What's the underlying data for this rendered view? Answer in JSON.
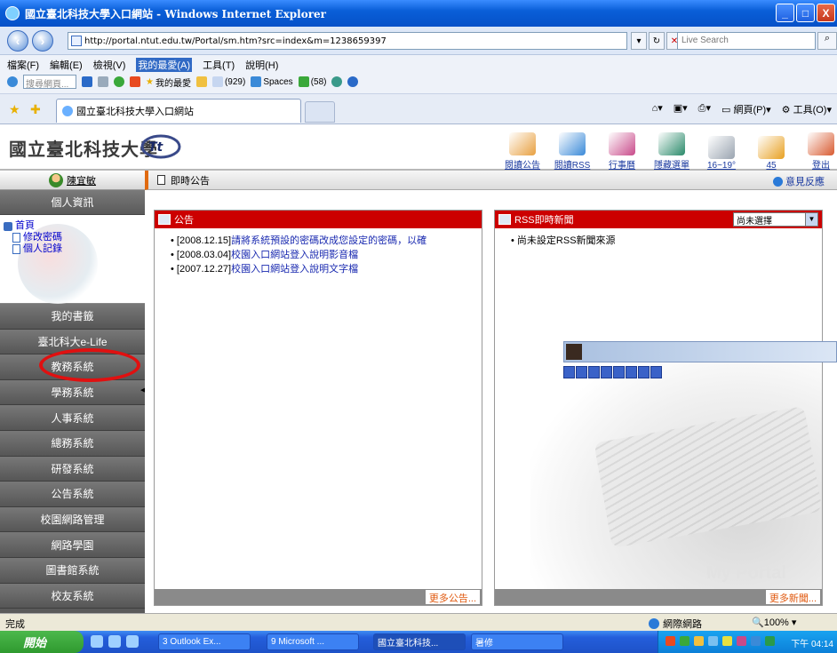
{
  "window": {
    "title": "國立臺北科技大學入口網站 - Windows Internet Explorer",
    "min": "_",
    "max": "□",
    "close": "X"
  },
  "addressbar": {
    "url": "http://portal.ntut.edu.tw/Portal/sm.htm?src=index&m=1238659397",
    "search_placeholder": "Live Search"
  },
  "menu": {
    "items": [
      "檔案(F)",
      "編輯(E)",
      "檢視(V)",
      "我的最愛(A)",
      "工具(T)",
      "說明(H)"
    ]
  },
  "links": {
    "search_placeholder": "搜尋網頁...",
    "favorites": "我的最愛",
    "mail_count": "(929)",
    "spaces": "Spaces",
    "contacts": "(58)"
  },
  "tabs": {
    "active_title": "國立臺北科技大學入口網站",
    "cmd_page": "網頁(P)",
    "cmd_tools": "工具(O)"
  },
  "portal": {
    "school_name": "國立臺北科技大學",
    "header_icons": [
      {
        "label": "閱讀公告",
        "icon": "bulletin-icon",
        "color": "#e8a040"
      },
      {
        "label": "閱讀RSS",
        "icon": "rss-icon",
        "color": "#3a8ad8"
      },
      {
        "label": "行事曆",
        "icon": "calendar-icon",
        "color": "#c84a8a"
      },
      {
        "label": "隱藏選單",
        "icon": "hide-menu-icon",
        "color": "#2a8a6a"
      },
      {
        "label": "16~19°",
        "icon": "weather-icon",
        "color": "#9aa4b0"
      },
      {
        "label": "45",
        "icon": "chart-icon",
        "color": "#e8a020"
      },
      {
        "label": "登出",
        "icon": "logout-icon",
        "color": "#d85a30"
      }
    ]
  },
  "sidebar": {
    "user": "陳宜敏",
    "personal_header": "個人資訊",
    "tree": {
      "root": "首頁",
      "children": [
        "修改密碼",
        "個人記錄"
      ]
    },
    "items": [
      "我的書籤",
      "臺北科大e-Life",
      "教務系統",
      "學務系統",
      "人事系統",
      "總務系統",
      "研發系統",
      "公告系統",
      "校園網路管理",
      "網路學園",
      "圖書館系統",
      "校友系統"
    ]
  },
  "content": {
    "title": "即時公告",
    "feedback": "意見反應",
    "announce": {
      "header": "公告",
      "items": [
        {
          "date": "[2008.12.15]",
          "text": "請將系統預設的密碼改成您設定的密碼，以確"
        },
        {
          "date": "[2008.03.04]",
          "text": "校園入口網站登入說明影音檔"
        },
        {
          "date": "[2007.12.27]",
          "text": "校園入口網站登入說明文字檔"
        }
      ],
      "more": "更多公告..."
    },
    "rss": {
      "header": "RSS即時新聞",
      "select_value": "尚未選擇",
      "items": [
        "尚未設定RSS新聞來源"
      ],
      "more": "更多新聞..."
    }
  },
  "status": {
    "done": "完成",
    "zone": "網際網路",
    "zoom": "100%"
  },
  "taskbar": {
    "start": "開始",
    "tasks": [
      "3 Outlook Ex...",
      "9 Microsoft ...",
      "國立臺北科技...",
      "暑修"
    ],
    "clock": "下午 04:14"
  }
}
